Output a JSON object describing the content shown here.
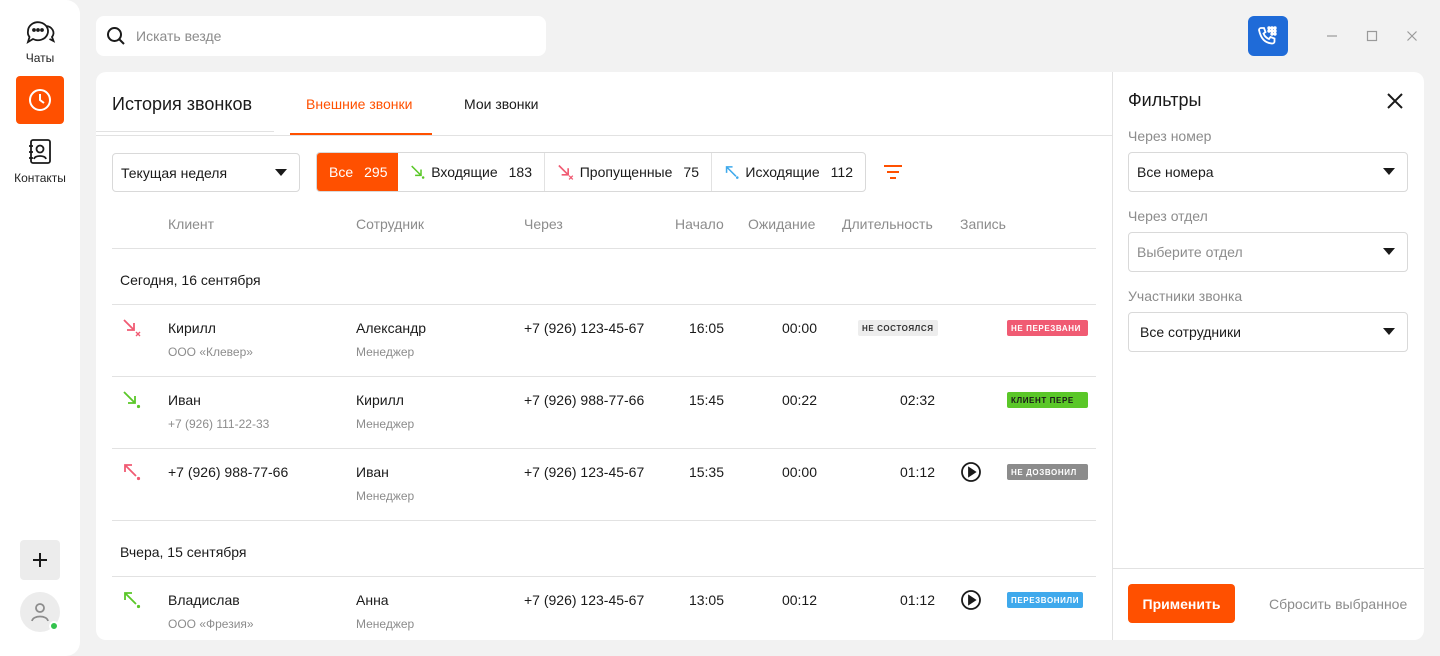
{
  "colors": {
    "accent": "#ff5000",
    "missed": "#f05b73",
    "incoming": "#5ac728",
    "outgoing": "#3fa9ec",
    "phone_button": "#1f6bd8",
    "online": "#33c24d"
  },
  "sidebar": {
    "items": [
      {
        "label": "Чаты",
        "icon": "chat-icon"
      },
      {
        "label": "",
        "icon": "clock-icon"
      },
      {
        "label": "Контакты",
        "icon": "contacts-icon"
      }
    ]
  },
  "search": {
    "placeholder": "Искать везде"
  },
  "header": {
    "title": "История звонков",
    "tabs": [
      {
        "label": "Внешние звонки"
      },
      {
        "label": "Мои звонки"
      }
    ]
  },
  "toolbar": {
    "period": "Текущая неделя",
    "segments": [
      {
        "label": "Все",
        "count": "295"
      },
      {
        "label": "Входящие",
        "count": "183"
      },
      {
        "label": "Пропущенные",
        "count": "75"
      },
      {
        "label": "Исходящие",
        "count": "112"
      }
    ]
  },
  "table": {
    "columns": [
      "Клиент",
      "Сотрудник",
      "Через",
      "Начало",
      "Ожидание",
      "Длительность",
      "Запись"
    ],
    "groups": [
      {
        "title": "Сегодня, 16 сентября",
        "rows": [
          {
            "direction": "missed",
            "client": "Кирилл",
            "client_sub": "ООО «Клевер»",
            "employee": "Александр",
            "employee_role": "Менеджер",
            "via": "+7 (926) 123-45-67",
            "start": "16:05",
            "wait": "00:00",
            "duration_badge": "Не состоялся",
            "status": "Не перезвани"
          },
          {
            "direction": "incoming",
            "client": "Иван",
            "client_sub": "+7 (926) 111-22-33",
            "employee": "Кирилл",
            "employee_role": "Менеджер",
            "via": "+7 (926) 988-77-66",
            "start": "15:45",
            "wait": "00:22",
            "duration": "02:32",
            "status": "Клиент пере"
          },
          {
            "direction": "missed",
            "client": "+7 (926) 988-77-66",
            "employee": "Иван",
            "employee_role": "Менеджер",
            "via": "+7 (926) 123-45-67",
            "start": "15:35",
            "wait": "00:00",
            "duration": "01:12",
            "status": "Не дозвонил"
          }
        ]
      },
      {
        "title": "Вчера, 15 сентября",
        "rows": [
          {
            "direction": "outgoing",
            "client": "Владислав",
            "client_sub": "ООО «Фрезия»",
            "employee": "Анна",
            "employee_role": "Менеджер",
            "via": "+7 (926) 123-45-67",
            "start": "13:05",
            "wait": "00:12",
            "duration": "01:12",
            "status": "Перезвонили"
          }
        ]
      }
    ]
  },
  "filters": {
    "title": "Фильтры",
    "number_label": "Через номер",
    "number_value": "Все номера",
    "dept_label": "Через отдел",
    "dept_placeholder": "Выберите отдел",
    "participants_label": "Участники звонка",
    "participants_value": "Все сотрудники",
    "apply": "Применить",
    "reset": "Сбросить выбранное"
  }
}
